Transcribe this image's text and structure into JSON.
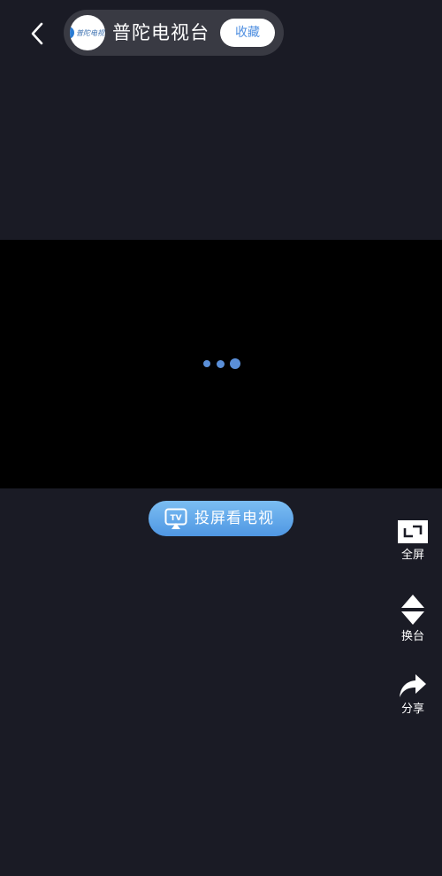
{
  "header": {
    "back_icon": "chevron-left-icon",
    "channel": {
      "logo_icon": "channel-logo",
      "logo_text": "普陀电视",
      "name": "普陀电视台",
      "favorite_label": "收藏"
    }
  },
  "player": {
    "loading_icon": "loading-dots-icon"
  },
  "cast": {
    "icon": "tv-cast-icon",
    "label": "投屏看电视"
  },
  "side_actions": [
    {
      "icon": "fullscreen-icon",
      "label": "全屏"
    },
    {
      "icon": "switch-channel-icon",
      "label": "换台"
    },
    {
      "icon": "share-icon",
      "label": "分享"
    }
  ],
  "colors": {
    "background": "#1a1b25",
    "pill": "#393a43",
    "accent": "#4f8fe0",
    "cast_gradient_top": "#7bbdf2",
    "cast_gradient_bottom": "#4f97e3"
  }
}
